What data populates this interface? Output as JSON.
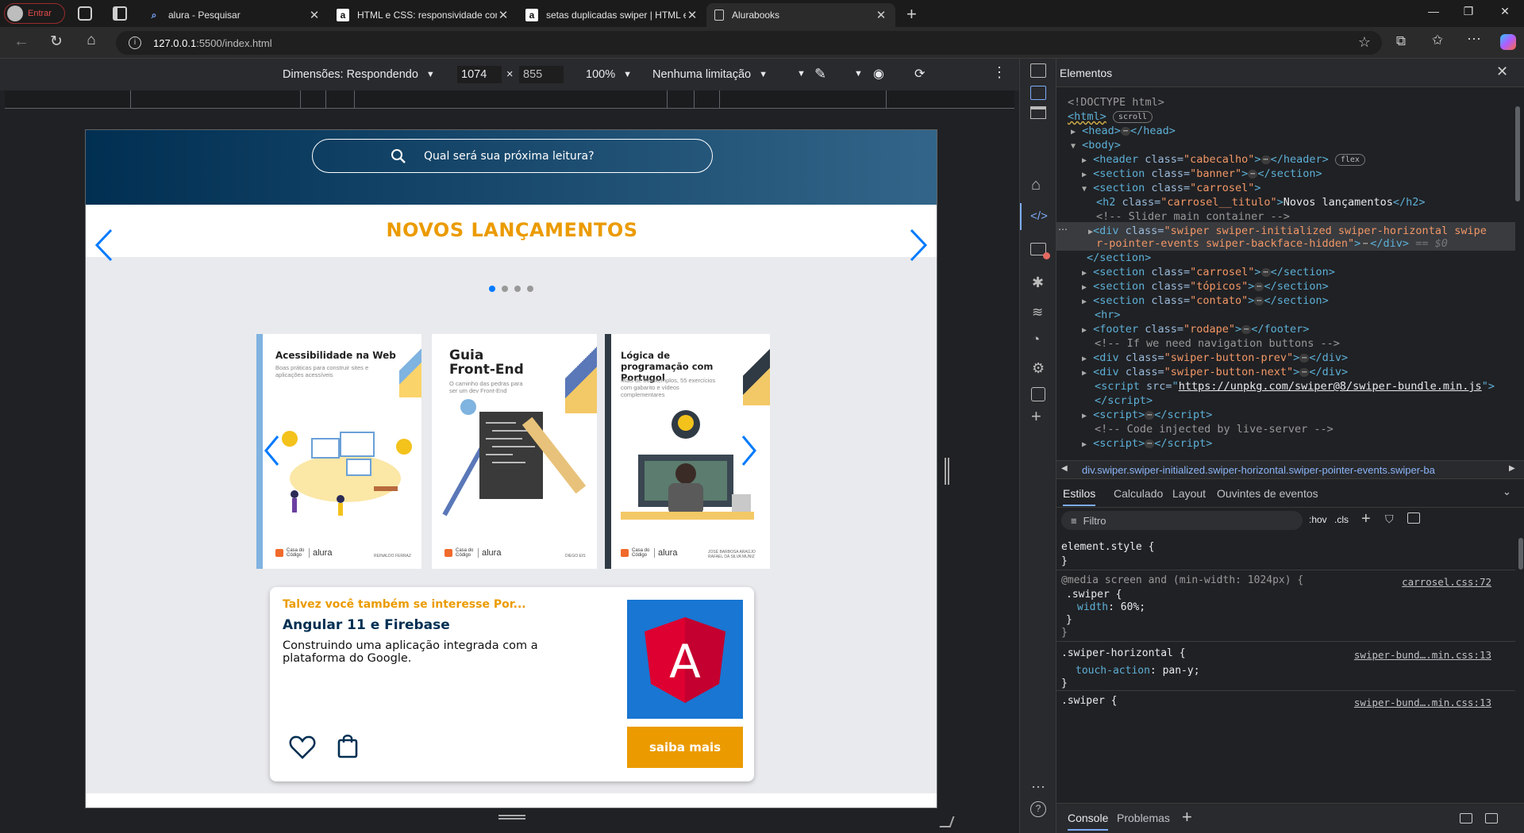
{
  "browser": {
    "profile_label": "Entrar",
    "tabs": [
      {
        "title": "alura - Pesquisar",
        "icon": "search-icon"
      },
      {
        "title": "HTML e CSS: responsividade com",
        "icon": "alura-icon"
      },
      {
        "title": "setas duplicadas swiper | HTML e",
        "icon": "alura-icon"
      },
      {
        "title": "Alurabooks",
        "icon": "page-icon",
        "active": true
      }
    ],
    "url_host": "127.0.0.1",
    "url_path": ":5500/index.html"
  },
  "device_toolbar": {
    "dimensions_label": "Dimensões: Respondendo",
    "width": "1074",
    "height": "855",
    "zoom": "100%",
    "throttle": "Nenhuma limitação"
  },
  "site": {
    "search_placeholder": "Qual será sua próxima leitura?",
    "carousel_title": "NOVOS LANÇAMENTOS",
    "books": [
      {
        "title": "Acessibilidade na Web",
        "subtitle": "Boas práticas para construir sites e aplicações acessíveis",
        "author": "REINALDO FERRAZ",
        "brand": "alura"
      },
      {
        "title": "Guia Front-End",
        "subtitle": "O caminho das pedras para ser um dev Front-End",
        "author": "DIEGO EIS",
        "brand": "alura"
      },
      {
        "title": "Lógica de programação com Portugol",
        "subtitle": "Mais de 80 exemplos, 55 exercícios com gabarito e vídeos complementares",
        "author": "JOSÉ BARBOSA ARAÚJO RAFAEL DA SILVA MUNIZ",
        "brand": "alura"
      }
    ],
    "publisher_label": "Casa do Código",
    "suggestion": {
      "kicker": "Talvez você também se interesse Por...",
      "title": "Angular 11 e Firebase",
      "description": "Construindo uma aplicação integrada com a plataforma do Google.",
      "button": "saiba mais",
      "logo_letter": "A"
    }
  },
  "devtools": {
    "panel_title": "Elementos",
    "dom": {
      "doctype": "<!DOCTYPE html>",
      "html_tag": "<html>",
      "scroll_badge": "scroll",
      "head": "<head>",
      "head_close": "</head>",
      "body": "<body>",
      "header_open": "<header ",
      "header_class_attr": "class=",
      "header_class": "\"cabecalho\"",
      "header_close": "</header>",
      "flex_badge": "flex",
      "section_banner": "\"banner\"",
      "section_carrosel": "\"carrosel\"",
      "h2_class": "\"carrosel__titulo\"",
      "h2_text": "Novos lançamentos",
      "comment_slider": "<!-- Slider main container -->",
      "swiper_class_1": "\"swiper swiper-initialized swiper-horizontal swipe",
      "swiper_class_2": "r-pointer-events swiper-backface-hidden\"",
      "swiper_eq": "== $0",
      "section_close": "</section>",
      "section_topicos": "\"tópicos\"",
      "section_contato": "\"contato\"",
      "hr": "<hr>",
      "footer_class": "\"rodape\"",
      "comment_nav": "<!-- If we need navigation buttons -->",
      "prev_class": "\"swiper-button-prev\"",
      "next_class": "\"swiper-button-next\"",
      "script_src": "https://unpkg.com/swiper@8/swiper-bundle.min.js",
      "comment_live": "<!-- Code injected by live-server -->"
    },
    "breadcrumb": "div.swiper.swiper-initialized.swiper-horizontal.swiper-pointer-events.swiper-ba",
    "style_tabs": [
      "Estilos",
      "Calculado",
      "Layout",
      "Ouvintes de eventos"
    ],
    "filter_placeholder": "Filtro",
    "hov": ":hov",
    "cls": ".cls",
    "rules": {
      "element_style": "element.style {",
      "media": "@media screen and (min-width: 1024px) {",
      "media_src": "carrosel.css:72",
      "swiper_sel": ".swiper {",
      "width_prop": "width",
      "width_val": "60%;",
      "horiz_sel": ".swiper-horizontal {",
      "horiz_src": "swiper-bund….min.css:13",
      "touch_prop": "touch-action",
      "touch_val": "pan-y;",
      "swiper2_sel": ".swiper {",
      "swiper2_src": "swiper-bund….min.css:13"
    },
    "drawer_tabs": [
      "Console",
      "Problemas"
    ]
  },
  "colors": {
    "site_header": "#002f52",
    "accent_orange": "#eb9b00",
    "swiper_blue": "#007aff",
    "devtools_bg": "#202124",
    "angular_red": "#dd0031"
  }
}
